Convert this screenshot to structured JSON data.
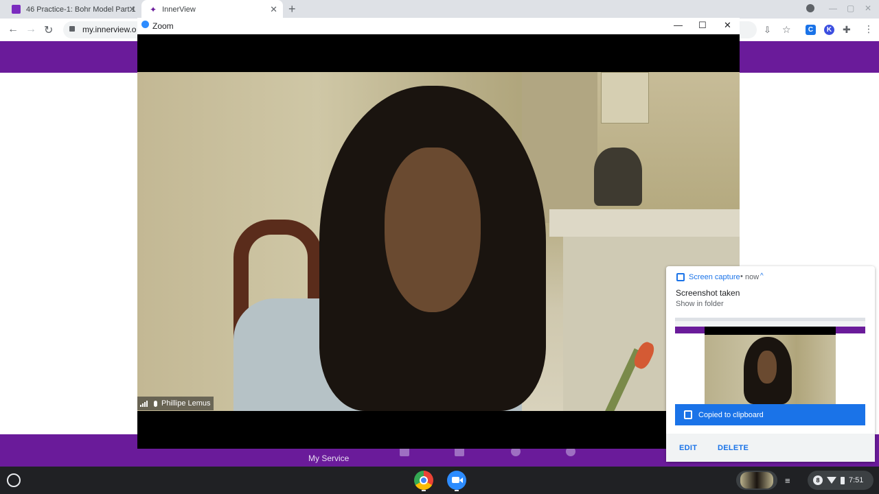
{
  "browser": {
    "tabs": [
      {
        "title": "46 Practice-1: Bohr Model Part 1"
      },
      {
        "title": "InnerView"
      }
    ],
    "new_tab_glyph": "+",
    "address": "my.innerview.o",
    "close_glyph": "✕"
  },
  "page": {
    "footer_label": "My Service"
  },
  "zoom": {
    "title": "Zoom",
    "minimize": "—",
    "maximize": "☐",
    "close": "✕",
    "participant_name": "Phillipe Lemus"
  },
  "notification": {
    "app": "Screen capture",
    "separator": "•",
    "time": "now",
    "chevron": "^",
    "title": "Screenshot taken",
    "subtitle": "Show in folder",
    "copied": "Copied to clipboard",
    "edit": "EDIT",
    "delete": "DELETE"
  },
  "shelf": {
    "notification_count": "8",
    "time": "7:51"
  },
  "colors": {
    "brand_purple": "#6a1b9a",
    "accent_blue": "#1a73e8",
    "zoom_blue": "#2d8cff"
  },
  "icons": [
    "reload-icon",
    "back-icon",
    "forward-icon",
    "lock-icon",
    "install-icon",
    "star-icon",
    "extension-icon",
    "screen-capture-icon",
    "clipboard-icon",
    "launcher-icon",
    "chrome-icon",
    "zoom-icon",
    "wifi-icon",
    "battery-icon"
  ]
}
